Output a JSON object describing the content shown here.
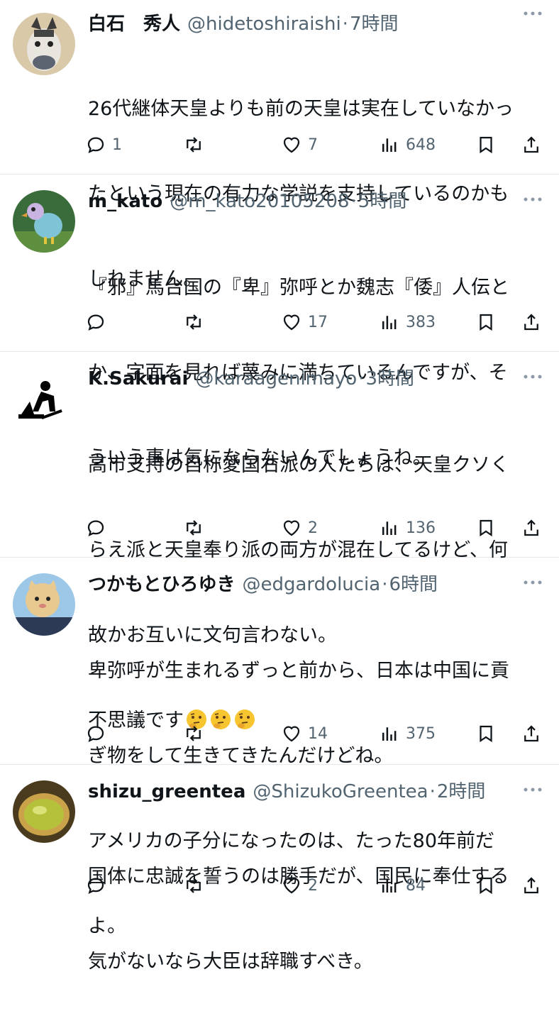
{
  "tweets": [
    {
      "name": "白石　秀人",
      "handle": "@hidetoshiraishi",
      "time": "7時間",
      "text": "26代継体天皇よりも前の天皇は実在していなかったという現在の有力な学説を支持しているのかもしれません。",
      "lines": [
        "26代継体天皇よりも前の天皇は実在していなかっ",
        "たという現在の有力な学説を支持しているのかも",
        "しれません。"
      ],
      "replies": "1",
      "retweets": "",
      "likes": "7",
      "views": "648",
      "avatar": "horse-mascot"
    },
    {
      "name": "m_kato",
      "handle": "@m_kato20105208",
      "time": "5時間",
      "lines": [
        "『邪』馬台国の『卑』弥呼とか魏志『倭』人伝と",
        "か、字面を見れば蔑みに満ちているんですが、そ",
        "ういう事は気にならないんでしょうね。"
      ],
      "replies": "",
      "retweets": "",
      "likes": "17",
      "views": "383",
      "avatar": "bird"
    },
    {
      "name": "K.Sakurai",
      "handle": "@karaagenimayo",
      "time": "3時間",
      "lines": [
        "高市支持の自称愛国右派の人たちは、天皇クソく",
        "らえ派と天皇奉り派の両方が混在してるけど、何",
        "故かお互いに文句言わない。",
        "不思議です"
      ],
      "emojis": [
        "thinking-face",
        "thinking-face",
        "thinking-face"
      ],
      "replies": "",
      "retweets": "",
      "likes": "2",
      "views": "136",
      "avatar": "worker-silhouette"
    },
    {
      "name": "つかもとひろゆき",
      "handle": "@edgardolucia",
      "time": "6時間",
      "lines": [
        "卑弥呼が生まれるずっと前から、日本は中国に貢",
        "ぎ物をして生きてきたんだけどね。",
        "アメリカの子分になったのは、たった80年前だ",
        "よ。"
      ],
      "replies": "",
      "retweets": "",
      "likes": "14",
      "views": "375",
      "avatar": "cat-balloon"
    },
    {
      "name": "shizu_greentea",
      "handle": "@ShizukoGreentea",
      "time": "2時間",
      "lines": [
        "国体に忠誠を誓うのは勝手だが、国民に奉仕する",
        "気がないなら大臣は辞職すべき。"
      ],
      "replies": "",
      "retweets": "",
      "likes": "2",
      "views": "84",
      "avatar": "green-tea"
    }
  ],
  "dot": "·",
  "colors": {
    "text": "#0f1419",
    "secondary": "#536471",
    "divider": "#e6e9eb"
  }
}
